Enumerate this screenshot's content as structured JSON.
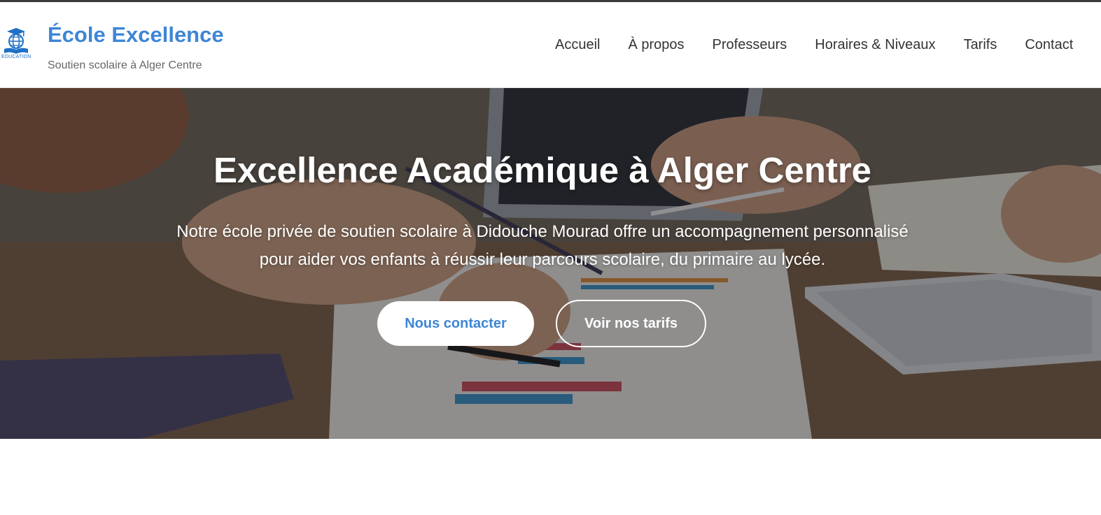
{
  "header": {
    "logo_caption": "EDUCATION",
    "brand_title": "École Excellence",
    "brand_tagline": "Soutien scolaire à Alger Centre",
    "nav": [
      {
        "label": "Accueil"
      },
      {
        "label": "À propos"
      },
      {
        "label": "Professeurs"
      },
      {
        "label": "Horaires & Niveaux"
      },
      {
        "label": "Tarifs"
      },
      {
        "label": "Contact"
      }
    ]
  },
  "hero": {
    "title": "Excellence Académique à Alger Centre",
    "text": "Notre école privée de soutien scolaire à Didouche Mourad offre un accompagnement personnalisé pour aider vos enfants à réussir leur parcours scolaire, du primaire au lycée.",
    "primary_button": "Nous contacter",
    "secondary_button": "Voir nos tarifs"
  },
  "colors": {
    "brand_blue": "#3d86d6",
    "nav_text": "#333333",
    "tagline_text": "#666666"
  },
  "icons": {
    "logo": "education-globe-book-icon"
  }
}
